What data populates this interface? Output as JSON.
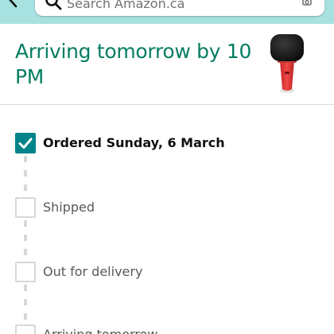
{
  "header": {
    "search_placeholder": "Search Amazon.ca",
    "icons": [
      "back-arrow-icon",
      "search-icon",
      "camera-scan-icon"
    ]
  },
  "delivery": {
    "title": "Arriving tomorrow by 10 PM",
    "product_icon": "microphone-product-image"
  },
  "timeline": {
    "steps": [
      {
        "label": "Ordered Sunday, 6 March",
        "completed": true
      },
      {
        "label": "Shipped",
        "completed": false
      },
      {
        "label": "Out for delivery",
        "completed": false
      },
      {
        "label": "Arriving tomorrow",
        "completed": false
      }
    ]
  },
  "colors": {
    "header_bg": "#a8e2e0",
    "title_green": "#067d62",
    "check_teal": "#00838a"
  }
}
